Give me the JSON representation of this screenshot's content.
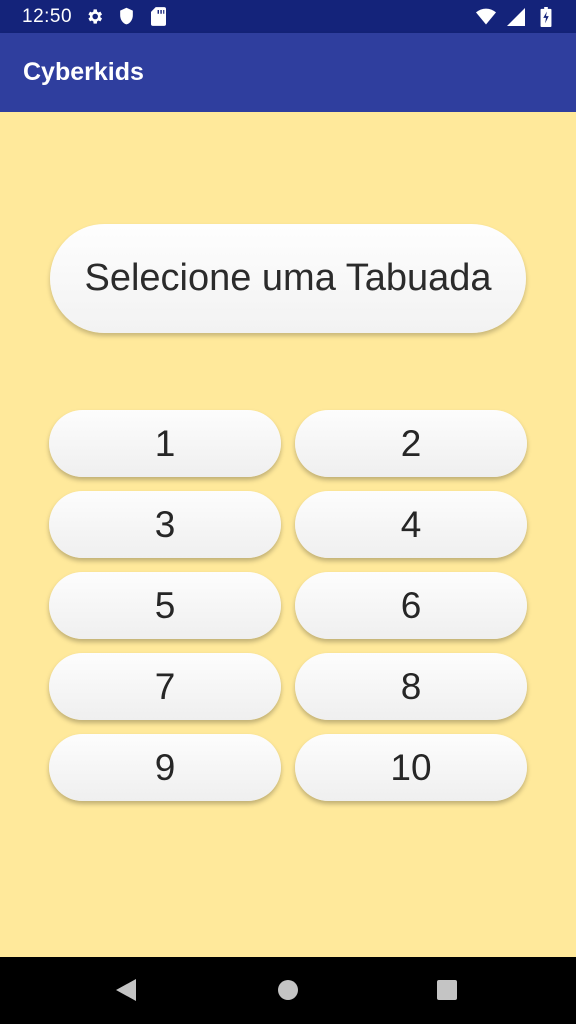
{
  "status_bar": {
    "time": "12:50",
    "icons": [
      "gear-icon",
      "shield-icon",
      "sd-card-icon",
      "wifi-icon",
      "signal-icon",
      "battery-charging-icon"
    ]
  },
  "app_bar": {
    "title": "Cyberkids"
  },
  "main": {
    "heading": "Selecione uma Tabuada",
    "buttons": [
      "1",
      "2",
      "3",
      "4",
      "5",
      "6",
      "7",
      "8",
      "9",
      "10"
    ]
  },
  "nav_bar": {
    "icons": [
      "back-icon",
      "home-icon",
      "recents-icon"
    ]
  },
  "colors": {
    "status_bar": "#14237a",
    "app_bar": "#2f3e9e",
    "background": "#ffe99b",
    "button": "#f7f7f7",
    "nav_bar": "#000000"
  }
}
